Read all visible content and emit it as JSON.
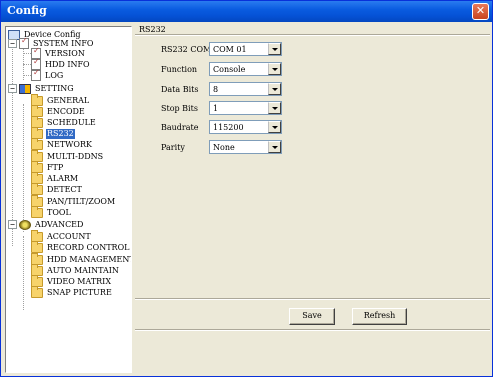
{
  "window": {
    "title": "Config"
  },
  "tree": {
    "root": "Device Config",
    "system_info": {
      "label": "SYSTEM INFO",
      "children": [
        "VERSION",
        "HDD INFO",
        "LOG"
      ]
    },
    "setting": {
      "label": "SETTING",
      "children": [
        "GENERAL",
        "ENCODE",
        "SCHEDULE",
        "RS232",
        "NETWORK",
        "MULTI-DDNS",
        "FTP",
        "ALARM",
        "DETECT",
        "PAN/TILT/ZOOM",
        "TOOL"
      ]
    },
    "advanced": {
      "label": "ADVANCED",
      "children": [
        "ACCOUNT",
        "RECORD CONTROL",
        "HDD MANAGEMENT",
        "AUTO MAINTAIN",
        "VIDEO MATRIX",
        "SNAP PICTURE"
      ]
    },
    "selected": "RS232",
    "expander_minus": "−"
  },
  "panel": {
    "section_title": "RS232",
    "fields": [
      {
        "label": "RS232 COM",
        "value": "COM 01"
      },
      {
        "label": "Function",
        "value": "Console"
      },
      {
        "label": "Data Bits",
        "value": "8"
      },
      {
        "label": "Stop Bits",
        "value": "1"
      },
      {
        "label": "Baudrate",
        "value": "115200"
      },
      {
        "label": "Parity",
        "value": "None"
      }
    ],
    "save_label": "Save",
    "refresh_label": "Refresh"
  }
}
